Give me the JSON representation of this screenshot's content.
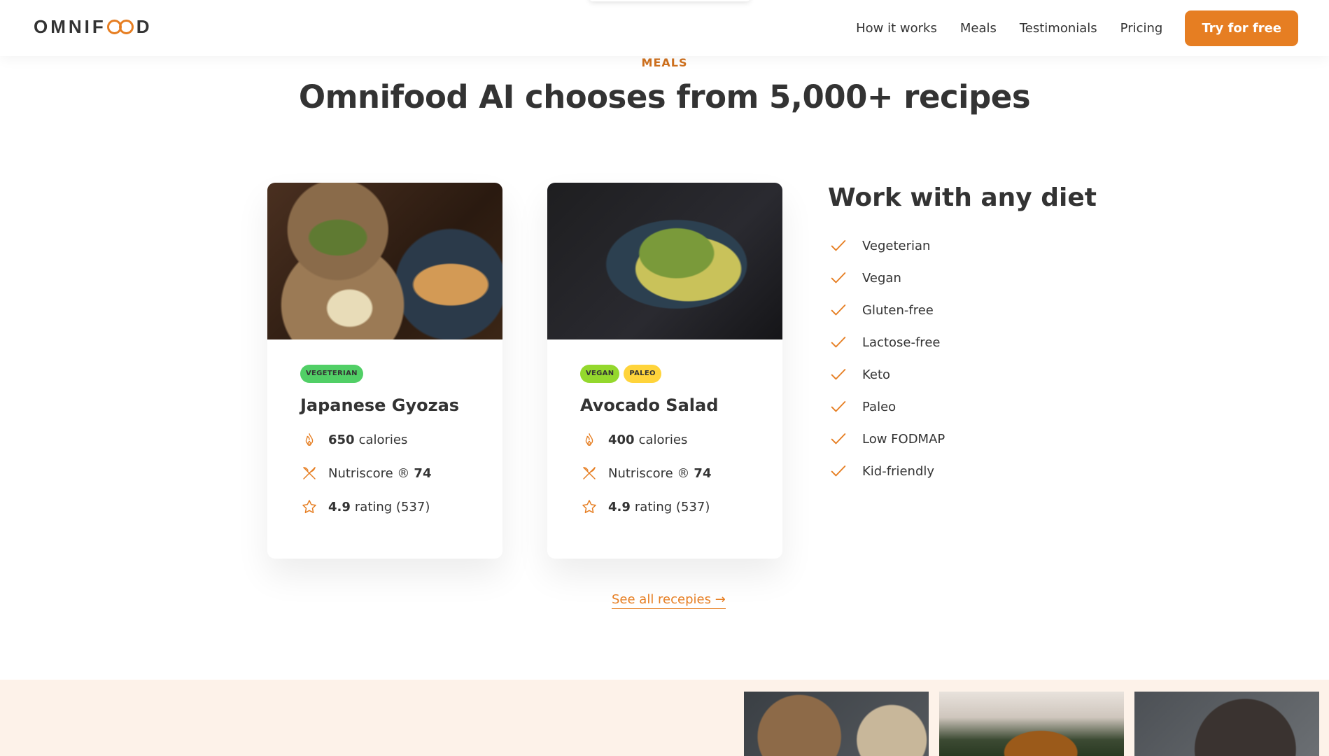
{
  "header": {
    "logo": "OMNIFOOD",
    "nav": [
      "How it works",
      "Meals",
      "Testimonials",
      "Pricing"
    ],
    "cta": "Try for free"
  },
  "section": {
    "subheading": "MEALS",
    "heading": "Omnifood AI chooses from 5,000+ recipes"
  },
  "meals": [
    {
      "tags": [
        "VEGETERIAN"
      ],
      "title": "Japanese Gyozas",
      "calories_value": "650",
      "calories_label": "calories",
      "nutriscore_label": "Nutriscore ®",
      "nutriscore_value": "74",
      "rating_value": "4.9",
      "rating_label": "rating (537)"
    },
    {
      "tags": [
        "VEGAN",
        "PALEO"
      ],
      "title": "Avocado Salad",
      "calories_value": "400",
      "calories_label": "calories",
      "nutriscore_label": "Nutriscore ®",
      "nutriscore_value": "74",
      "rating_value": "4.9",
      "rating_label": "rating (537)"
    }
  ],
  "diets": {
    "title": "Work with any diet",
    "items": [
      "Vegeterian",
      "Vegan",
      "Gluten-free",
      "Lactose-free",
      "Keto",
      "Paleo",
      "Low FODMAP",
      "Kid-friendly"
    ]
  },
  "see_all": "See all recepies →",
  "colors": {
    "accent": "#e67e22",
    "accent_dark": "#cf711f",
    "tag_vegetarian": "#51cf66",
    "tag_vegan": "#94d82d",
    "tag_paleo": "#ffd43b",
    "bottom_strip": "#fdf2e9"
  },
  "icons": {
    "calories": "flame-icon",
    "nutriscore": "utensils-icon",
    "rating": "star-icon",
    "diet": "checkmark-icon"
  }
}
